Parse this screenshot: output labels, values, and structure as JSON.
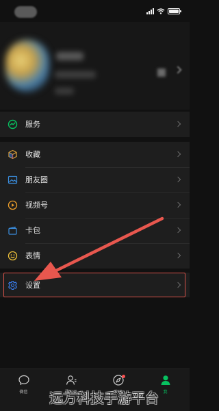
{
  "status_bar": {
    "battery_level": 1.0
  },
  "menu": {
    "services": {
      "label": "服务",
      "icon": "wechat-pay-icon",
      "color": "#07c160"
    },
    "main_items": [
      {
        "label": "收藏",
        "icon": "favorites-cube-icon"
      },
      {
        "label": "朋友圈",
        "icon": "moments-picture-icon"
      },
      {
        "label": "视频号",
        "icon": "channels-play-icon"
      },
      {
        "label": "卡包",
        "icon": "card-wallet-icon"
      },
      {
        "label": "表情",
        "icon": "sticker-smile-icon"
      }
    ],
    "settings": {
      "label": "设置",
      "icon": "gear-icon",
      "color": "#3b82f6"
    }
  },
  "tabs": [
    {
      "label": "微信",
      "icon": "chat-bubble-icon",
      "active": false
    },
    {
      "label": "通讯录",
      "icon": "contacts-icon",
      "active": false
    },
    {
      "label": "发现",
      "icon": "compass-icon",
      "active": false,
      "badge": true
    },
    {
      "label": "我",
      "icon": "me-person-icon",
      "active": true
    }
  ],
  "annotation": {
    "highlight_color": "#d9534a",
    "arrow_color": "#e8574e"
  },
  "watermark": {
    "text": "远方科技手游平台"
  }
}
